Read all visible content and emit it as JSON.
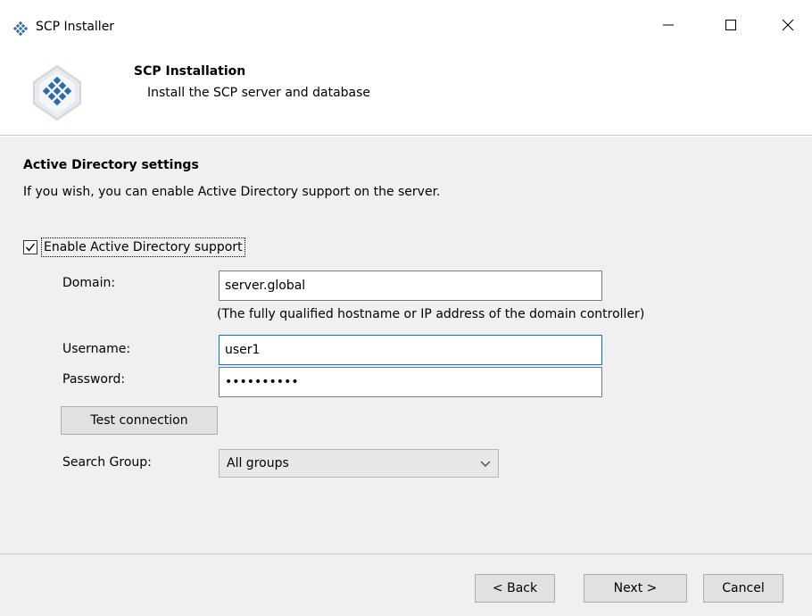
{
  "window": {
    "title": "SCP Installer",
    "app_icon": "scp-diamond-icon",
    "controls": [
      "minimize-icon",
      "maximize-icon",
      "close-icon"
    ]
  },
  "header": {
    "title": "SCP Installation",
    "subtitle": "Install the SCP server and database",
    "logo_icon": "scp-logo-icon"
  },
  "section": {
    "title": "Active Directory settings",
    "description": "If you wish, you can enable Active Directory support on the server."
  },
  "ad_support": {
    "label": "Enable Active Directory support",
    "checked": true
  },
  "form": {
    "domain_label": "Domain:",
    "domain_value": "server.global",
    "domain_hint": "(The fully qualified hostname or IP address of the domain controller)",
    "username_label": "Username:",
    "username_value": "user1",
    "password_label": "Password:",
    "password_value": "••••••••••",
    "test_button": "Test connection",
    "search_group_label": "Search Group:",
    "search_group_value": "All groups"
  },
  "footer": {
    "back": "< Back",
    "next": "Next >",
    "cancel": "Cancel"
  },
  "colors": {
    "accent": "#0078d7",
    "panel": "#f0f0f0",
    "button": "#e1e1e1"
  }
}
